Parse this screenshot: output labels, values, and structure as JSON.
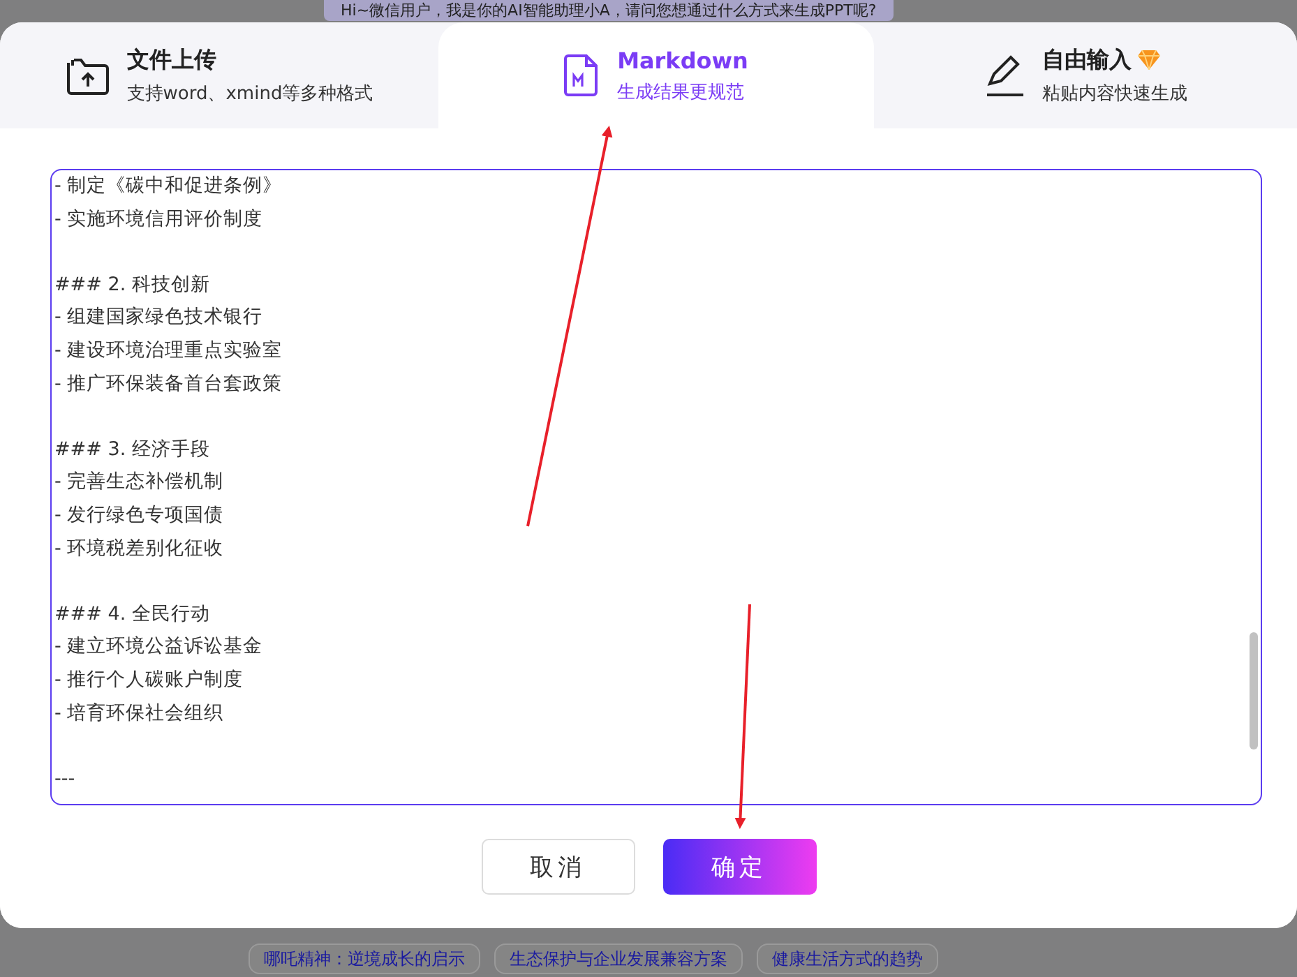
{
  "background": {
    "greeting": "Hi~微信用户，我是你的AI智能助理小A，请问您想通过什么方式来生成PPT呢?",
    "suggestions": [
      "哪吒精神：逆境成长的启示",
      "生态保护与企业发展兼容方案",
      "健康生活方式的趋势"
    ]
  },
  "dialog": {
    "tabs": [
      {
        "kind": "upload",
        "title": "文件上传",
        "subtitle": "支持word、xmind等多种格式",
        "selected": false,
        "badge": false
      },
      {
        "kind": "markdown",
        "title": "Markdown",
        "subtitle": "生成结果更规范",
        "selected": true,
        "badge": false
      },
      {
        "kind": "free",
        "title": "自由输入",
        "subtitle": "粘贴内容快速生成",
        "selected": false,
        "badge": true
      }
    ],
    "editor": {
      "value": "- 制定《碳中和促进条例》\n- 实施环境信用评价制度\n\n### 2. 科技创新\n- 组建国家绿色技术银行\n- 建设环境治理重点实验室\n- 推广环保装备首台套政策\n\n### 3. 经济手段\n- 完善生态补偿机制\n- 发行绿色专项国债\n- 环境税差别化征收\n\n### 4. 全民行动\n- 建立环境公益诉讼基金\n- 推行个人碳账户制度\n- 培育环保社会组织\n\n---"
    },
    "buttons": [
      {
        "kind": "cancel",
        "label": "取消"
      },
      {
        "kind": "confirm",
        "label": "确定"
      }
    ]
  }
}
